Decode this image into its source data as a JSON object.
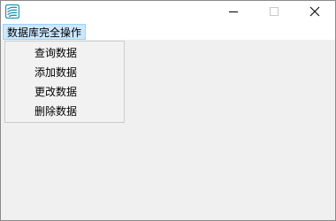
{
  "window": {
    "icon": "app-logo-icon",
    "controls": {
      "minimize_icon": "minimize-icon",
      "maximize_icon": "maximize-icon",
      "close_icon": "close-icon"
    }
  },
  "menubar": {
    "items": [
      {
        "label": "数据库完全操作"
      }
    ]
  },
  "dropdown": {
    "items": [
      {
        "label": "查询数据"
      },
      {
        "label": "添加数据"
      },
      {
        "label": "更改数据"
      },
      {
        "label": "删除数据"
      }
    ]
  },
  "colors": {
    "titlebar": "#ffffff",
    "client": "#f0f0f0",
    "menu_highlight": "#cce8ff",
    "icon_accent": "#1a8fb0"
  }
}
